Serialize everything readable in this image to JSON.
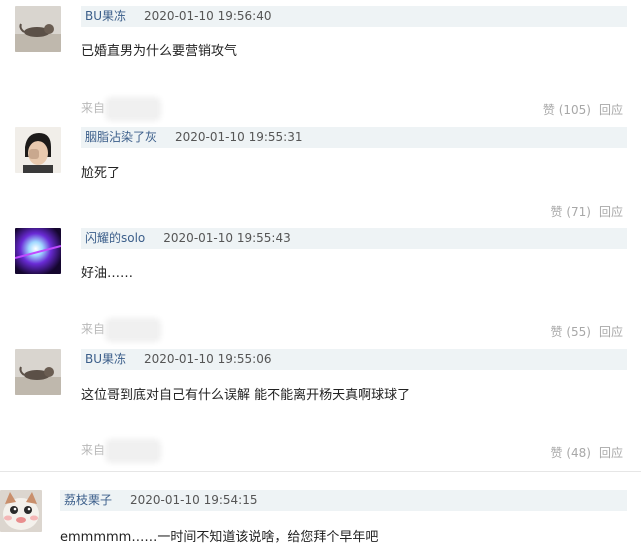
{
  "comments": [
    {
      "username": "BU果冻",
      "time": "2020-01-10 19:56:40",
      "text": "已婚直男为什么要营销攻气",
      "from_label": "来自",
      "like": "赞 (105)",
      "reply": "回应",
      "avatar_icon": "cat-lying-avatar-icon"
    },
    {
      "username": "胭脂沾染了灰",
      "time": "2020-01-10 19:55:31",
      "text": "尬死了",
      "from_label": "",
      "like": "赞 (71)",
      "reply": "回应",
      "avatar_icon": "person-face-avatar-icon"
    },
    {
      "username": "闪耀的solo",
      "time": "2020-01-10 19:55:43",
      "text": "好油……",
      "from_label": "来自",
      "like": "赞 (55)",
      "reply": "回应",
      "avatar_icon": "neon-light-avatar-icon"
    },
    {
      "username": "BU果冻",
      "time": "2020-01-10 19:55:06",
      "text": "这位哥到底对自己有什么误解 能不能离开杨天真啊球球了",
      "from_label": "来自",
      "like": "赞 (48)",
      "reply": "回应",
      "avatar_icon": "cat-lying-avatar-icon"
    },
    {
      "username": "荔枝栗子",
      "time": "2020-01-10 19:54:15",
      "text": "emmmmm……一时间不知道该说啥，给您拜个早年吧",
      "from_label": "",
      "like": "",
      "reply": "",
      "avatar_icon": "cat-face-avatar-icon"
    }
  ]
}
